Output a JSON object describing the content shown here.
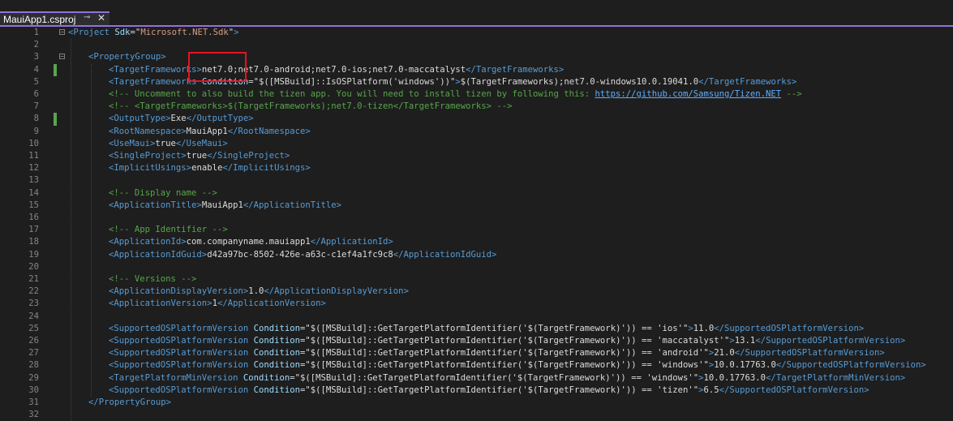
{
  "tab": {
    "title": "MauiApp1.csproj",
    "pin_icon": "pin-icon",
    "close_icon": "close-icon"
  },
  "colors": {
    "accent": "#9370db",
    "highlight": "#e81123",
    "change_bar": "#57a64a"
  },
  "lines": [
    {
      "n": "1",
      "indent": 0,
      "fold": true,
      "changed": false,
      "parts": [
        [
          "t",
          "<Project "
        ],
        [
          "a",
          "Sdk"
        ],
        [
          "q",
          "=\""
        ],
        [
          "s",
          "Microsoft.NET.Sdk"
        ],
        [
          "q",
          "\""
        ],
        [
          "t",
          ">"
        ]
      ]
    },
    {
      "n": "2",
      "indent": 0,
      "fold": false,
      "changed": false,
      "parts": []
    },
    {
      "n": "3",
      "indent": 1,
      "fold": true,
      "changed": false,
      "parts": [
        [
          "t",
          "<PropertyGroup>"
        ]
      ]
    },
    {
      "n": "4",
      "indent": 2,
      "fold": false,
      "changed": true,
      "parts": [
        [
          "t",
          "<TargetFrameworks>"
        ],
        [
          "v",
          "net7.0;net7.0-android;net7.0-ios;net7.0-maccatalyst"
        ],
        [
          "t",
          "</TargetFrameworks>"
        ]
      ]
    },
    {
      "n": "5",
      "indent": 2,
      "fold": false,
      "changed": false,
      "parts": [
        [
          "t",
          "<TargetFrameworks "
        ],
        [
          "a",
          "Condition"
        ],
        [
          "q",
          "=\""
        ],
        [
          "v",
          "$([MSBuild]::IsOSPlatform('windows'))"
        ],
        [
          "q",
          "\""
        ],
        [
          "t",
          ">"
        ],
        [
          "v",
          "$(TargetFrameworks);net7.0-windows10.0.19041.0"
        ],
        [
          "t",
          "</TargetFrameworks>"
        ]
      ]
    },
    {
      "n": "6",
      "indent": 2,
      "fold": false,
      "changed": false,
      "parts": [
        [
          "c",
          "<!-- Uncomment to also build the tizen app. You will need to install tizen by following this: "
        ],
        [
          "l",
          "https://github.com/Samsung/Tizen.NET"
        ],
        [
          "c",
          " -->"
        ]
      ]
    },
    {
      "n": "7",
      "indent": 2,
      "fold": false,
      "changed": false,
      "parts": [
        [
          "c",
          "<!-- <TargetFrameworks>$(TargetFrameworks);net7.0-tizen</TargetFrameworks> -->"
        ]
      ]
    },
    {
      "n": "8",
      "indent": 2,
      "fold": false,
      "changed": true,
      "parts": [
        [
          "t",
          "<OutputType>"
        ],
        [
          "v",
          "Exe"
        ],
        [
          "t",
          "</OutputType>"
        ]
      ]
    },
    {
      "n": "9",
      "indent": 2,
      "fold": false,
      "changed": false,
      "parts": [
        [
          "t",
          "<RootNamespace>"
        ],
        [
          "v",
          "MauiApp1"
        ],
        [
          "t",
          "</RootNamespace>"
        ]
      ]
    },
    {
      "n": "10",
      "indent": 2,
      "fold": false,
      "changed": false,
      "parts": [
        [
          "t",
          "<UseMaui>"
        ],
        [
          "v",
          "true"
        ],
        [
          "t",
          "</UseMaui>"
        ]
      ]
    },
    {
      "n": "11",
      "indent": 2,
      "fold": false,
      "changed": false,
      "parts": [
        [
          "t",
          "<SingleProject>"
        ],
        [
          "v",
          "true"
        ],
        [
          "t",
          "</SingleProject>"
        ]
      ]
    },
    {
      "n": "12",
      "indent": 2,
      "fold": false,
      "changed": false,
      "parts": [
        [
          "t",
          "<ImplicitUsings>"
        ],
        [
          "v",
          "enable"
        ],
        [
          "t",
          "</ImplicitUsings>"
        ]
      ]
    },
    {
      "n": "13",
      "indent": 2,
      "fold": false,
      "changed": false,
      "parts": []
    },
    {
      "n": "14",
      "indent": 2,
      "fold": false,
      "changed": false,
      "parts": [
        [
          "c",
          "<!-- Display name -->"
        ]
      ]
    },
    {
      "n": "15",
      "indent": 2,
      "fold": false,
      "changed": false,
      "parts": [
        [
          "t",
          "<ApplicationTitle>"
        ],
        [
          "v",
          "MauiApp1"
        ],
        [
          "t",
          "</ApplicationTitle>"
        ]
      ]
    },
    {
      "n": "16",
      "indent": 2,
      "fold": false,
      "changed": false,
      "parts": []
    },
    {
      "n": "17",
      "indent": 2,
      "fold": false,
      "changed": false,
      "parts": [
        [
          "c",
          "<!-- App Identifier -->"
        ]
      ]
    },
    {
      "n": "18",
      "indent": 2,
      "fold": false,
      "changed": false,
      "parts": [
        [
          "t",
          "<ApplicationId>"
        ],
        [
          "v",
          "com.companyname.mauiapp1"
        ],
        [
          "t",
          "</ApplicationId>"
        ]
      ]
    },
    {
      "n": "19",
      "indent": 2,
      "fold": false,
      "changed": false,
      "parts": [
        [
          "t",
          "<ApplicationIdGuid>"
        ],
        [
          "v",
          "d42a97bc-8502-426e-a63c-c1ef4a1fc9c8"
        ],
        [
          "t",
          "</ApplicationIdGuid>"
        ]
      ]
    },
    {
      "n": "20",
      "indent": 2,
      "fold": false,
      "changed": false,
      "parts": []
    },
    {
      "n": "21",
      "indent": 2,
      "fold": false,
      "changed": false,
      "parts": [
        [
          "c",
          "<!-- Versions -->"
        ]
      ]
    },
    {
      "n": "22",
      "indent": 2,
      "fold": false,
      "changed": false,
      "parts": [
        [
          "t",
          "<ApplicationDisplayVersion>"
        ],
        [
          "v",
          "1.0"
        ],
        [
          "t",
          "</ApplicationDisplayVersion>"
        ]
      ]
    },
    {
      "n": "23",
      "indent": 2,
      "fold": false,
      "changed": false,
      "parts": [
        [
          "t",
          "<ApplicationVersion>"
        ],
        [
          "v",
          "1"
        ],
        [
          "t",
          "</ApplicationVersion>"
        ]
      ]
    },
    {
      "n": "24",
      "indent": 2,
      "fold": false,
      "changed": false,
      "parts": []
    },
    {
      "n": "25",
      "indent": 2,
      "fold": false,
      "changed": false,
      "parts": [
        [
          "t",
          "<SupportedOSPlatformVersion "
        ],
        [
          "a",
          "Condition"
        ],
        [
          "q",
          "=\""
        ],
        [
          "v",
          "$([MSBuild]::GetTargetPlatformIdentifier('$(TargetFramework)')) == 'ios'"
        ],
        [
          "q",
          "\""
        ],
        [
          "t",
          ">"
        ],
        [
          "v",
          "11.0"
        ],
        [
          "t",
          "</SupportedOSPlatformVersion>"
        ]
      ]
    },
    {
      "n": "26",
      "indent": 2,
      "fold": false,
      "changed": false,
      "parts": [
        [
          "t",
          "<SupportedOSPlatformVersion "
        ],
        [
          "a",
          "Condition"
        ],
        [
          "q",
          "=\""
        ],
        [
          "v",
          "$([MSBuild]::GetTargetPlatformIdentifier('$(TargetFramework)')) == 'maccatalyst'"
        ],
        [
          "q",
          "\""
        ],
        [
          "t",
          ">"
        ],
        [
          "v",
          "13.1"
        ],
        [
          "t",
          "</SupportedOSPlatformVersion>"
        ]
      ]
    },
    {
      "n": "27",
      "indent": 2,
      "fold": false,
      "changed": false,
      "parts": [
        [
          "t",
          "<SupportedOSPlatformVersion "
        ],
        [
          "a",
          "Condition"
        ],
        [
          "q",
          "=\""
        ],
        [
          "v",
          "$([MSBuild]::GetTargetPlatformIdentifier('$(TargetFramework)')) == 'android'"
        ],
        [
          "q",
          "\""
        ],
        [
          "t",
          ">"
        ],
        [
          "v",
          "21.0"
        ],
        [
          "t",
          "</SupportedOSPlatformVersion>"
        ]
      ]
    },
    {
      "n": "28",
      "indent": 2,
      "fold": false,
      "changed": false,
      "parts": [
        [
          "t",
          "<SupportedOSPlatformVersion "
        ],
        [
          "a",
          "Condition"
        ],
        [
          "q",
          "=\""
        ],
        [
          "v",
          "$([MSBuild]::GetTargetPlatformIdentifier('$(TargetFramework)')) == 'windows'"
        ],
        [
          "q",
          "\""
        ],
        [
          "t",
          ">"
        ],
        [
          "v",
          "10.0.17763.0"
        ],
        [
          "t",
          "</SupportedOSPlatformVersion>"
        ]
      ]
    },
    {
      "n": "29",
      "indent": 2,
      "fold": false,
      "changed": false,
      "parts": [
        [
          "t",
          "<TargetPlatformMinVersion "
        ],
        [
          "a",
          "Condition"
        ],
        [
          "q",
          "=\""
        ],
        [
          "v",
          "$([MSBuild]::GetTargetPlatformIdentifier('$(TargetFramework)')) == 'windows'"
        ],
        [
          "q",
          "\""
        ],
        [
          "t",
          ">"
        ],
        [
          "v",
          "10.0.17763.0"
        ],
        [
          "t",
          "</TargetPlatformMinVersion>"
        ]
      ]
    },
    {
      "n": "30",
      "indent": 2,
      "fold": false,
      "changed": false,
      "parts": [
        [
          "t",
          "<SupportedOSPlatformVersion "
        ],
        [
          "a",
          "Condition"
        ],
        [
          "q",
          "=\""
        ],
        [
          "v",
          "$([MSBuild]::GetTargetPlatformIdentifier('$(TargetFramework)')) == 'tizen'"
        ],
        [
          "q",
          "\""
        ],
        [
          "t",
          ">"
        ],
        [
          "v",
          "6.5"
        ],
        [
          "t",
          "</SupportedOSPlatformVersion>"
        ]
      ]
    },
    {
      "n": "31",
      "indent": 1,
      "fold": false,
      "changed": false,
      "parts": [
        [
          "t",
          "</PropertyGroup>"
        ]
      ]
    },
    {
      "n": "32",
      "indent": 0,
      "fold": false,
      "changed": false,
      "parts": []
    }
  ]
}
